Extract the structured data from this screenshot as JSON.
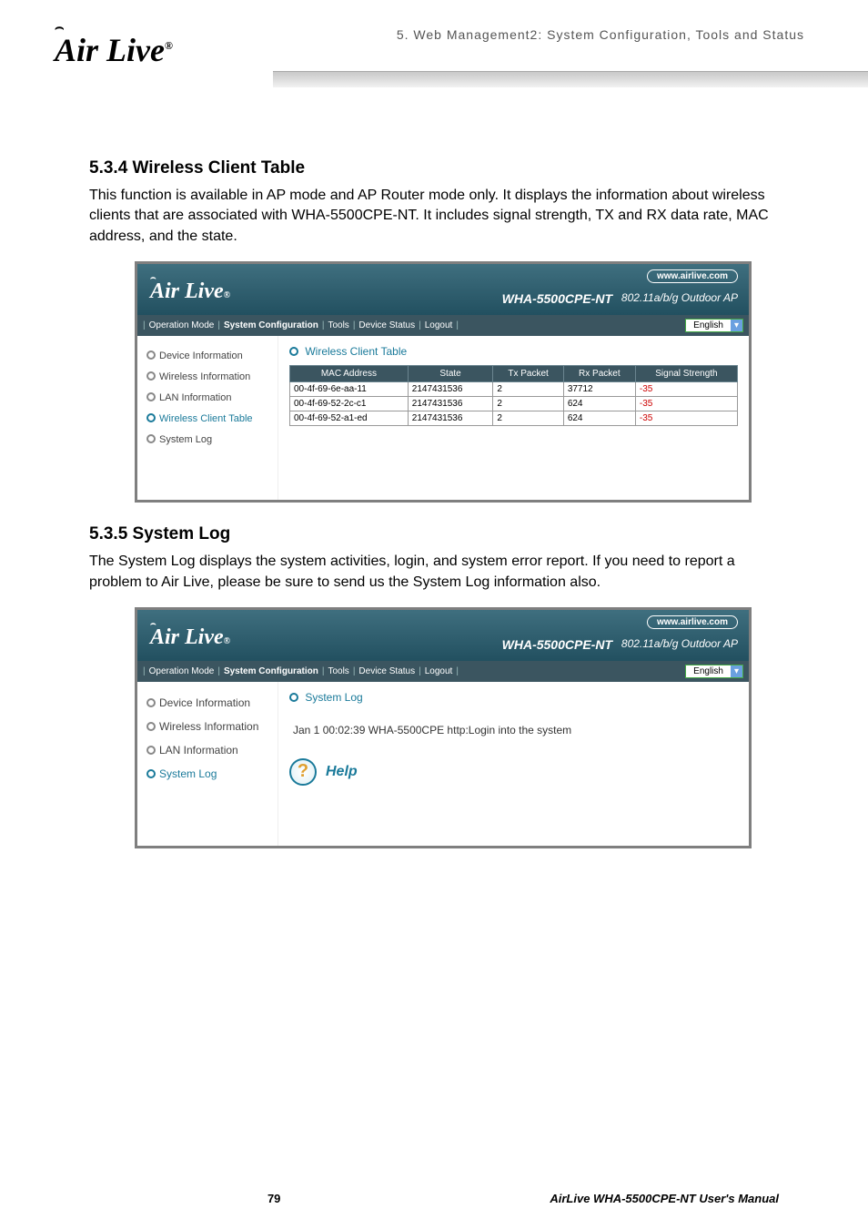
{
  "header": {
    "logo_text": "Air Live",
    "logo_reg": "®",
    "chapter": "5.  Web  Management2:  System  Configuration,  Tools  and  Status"
  },
  "s1": {
    "heading": "5.3.4 Wireless Client Table",
    "para": "This function is available in AP mode and AP Router mode only.    It displays the information about wireless clients that are associated with WHA-5500CPE-NT.    It includes signal strength, TX and RX data rate, MAC address, and the state."
  },
  "s2": {
    "heading": "5.3.5 System Log",
    "para": "The System Log displays the system activities, login, and system error report.    If you need to report a problem to Air Live, please be sure to send us the System Log information also."
  },
  "shot1": {
    "logo": "Air Live",
    "url": "www.airlive.com",
    "model": "WHA-5500CPE-NT",
    "mode": "802.11a/b/g Outdoor AP",
    "nav": {
      "op": "Operation Mode",
      "sys": "System Configuration",
      "tools": "Tools",
      "dev": "Device Status",
      "logout": "Logout",
      "sep": "|"
    },
    "lang": "English",
    "side": {
      "i0": "Device Information",
      "i1": "Wireless Information",
      "i2": "LAN Information",
      "i3": "Wireless Client Table",
      "i4": "System Log"
    },
    "main_title": "Wireless Client Table",
    "th": {
      "mac": "MAC Address",
      "state": "State",
      "tx": "Tx Packet",
      "rx": "Rx Packet",
      "sig": "Signal Strength"
    },
    "rows": {
      "r0": {
        "mac": "00-4f-69-6e-aa-11",
        "state": "2147431536",
        "tx": "2",
        "rx": "37712",
        "sig": "-35"
      },
      "r1": {
        "mac": "00-4f-69-52-2c-c1",
        "state": "2147431536",
        "tx": "2",
        "rx": "624",
        "sig": "-35"
      },
      "r2": {
        "mac": "00-4f-69-52-a1-ed",
        "state": "2147431536",
        "tx": "2",
        "rx": "624",
        "sig": "-35"
      }
    }
  },
  "shot2": {
    "logo": "Air Live",
    "url": "www.airlive.com",
    "model": "WHA-5500CPE-NT",
    "mode": "802.11a/b/g Outdoor AP",
    "nav": {
      "op": "Operation Mode",
      "sys": "System Configuration",
      "tools": "Tools",
      "dev": "Device Status",
      "logout": "Logout",
      "sep": "|"
    },
    "lang": "English",
    "side": {
      "i0": "Device Information",
      "i1": "Wireless Information",
      "i2": "LAN Information",
      "i3": "System Log"
    },
    "main_title": "System Log",
    "log_line": "Jan 1 00:02:39 WHA-5500CPE http:Login into the system",
    "help": "Help",
    "help_q": "?"
  },
  "footer": {
    "page": "79",
    "manual": "AirLive  WHA-5500CPE-NT  User's  Manual"
  }
}
